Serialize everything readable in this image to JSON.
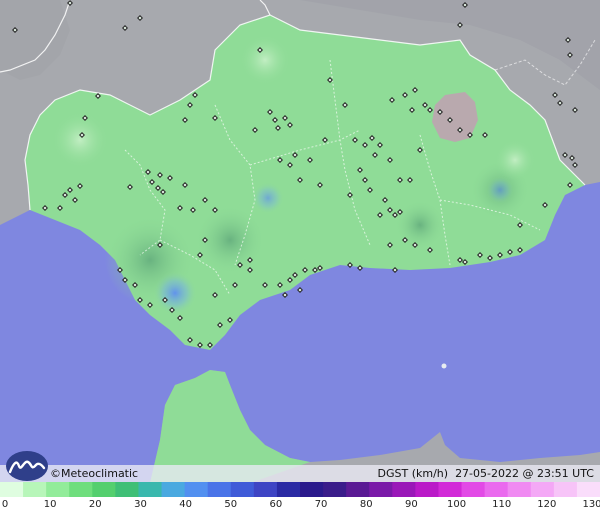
{
  "map": {
    "colors": {
      "sea": "#7f87e0",
      "land_outside": "#a7a9ae",
      "region_fill": "#8fdc97",
      "region_dark": "#6fbf7a",
      "borders": "#ffffff",
      "station_marker": "#222222",
      "cloud_patch": "#b9a9ae",
      "hotspot": "#79a7e8"
    }
  },
  "footer": {
    "brand": "©Meteoclimatic",
    "variable_label": "DGST (km/h)",
    "timestamp": "27-05-2022 @ 23:51 UTC",
    "logo_icon": "meteoclimatic-logo-icon"
  },
  "legend": {
    "unit": "km/h",
    "ticks": [
      "0",
      "10",
      "20",
      "30",
      "40",
      "50",
      "60",
      "70",
      "80",
      "90",
      "100",
      "110",
      "120",
      "130"
    ],
    "ramp_colors": [
      "#dffde0",
      "#b7f6b9",
      "#92ec9a",
      "#6fde7d",
      "#54cf6e",
      "#3fbf76",
      "#39b8ad",
      "#4aa9e0",
      "#5290f0",
      "#4a74e8",
      "#3f5bd8",
      "#3e44c4",
      "#2a2aa4",
      "#2a1a8c",
      "#3a1c8a",
      "#5a1a94",
      "#7a1aa8",
      "#9a18b8",
      "#ba1ac8",
      "#d22ad8",
      "#e24ae6",
      "#ea6aee",
      "#f08af2",
      "#f4a8f6",
      "#f7c4f8",
      "#faddfb"
    ]
  }
}
